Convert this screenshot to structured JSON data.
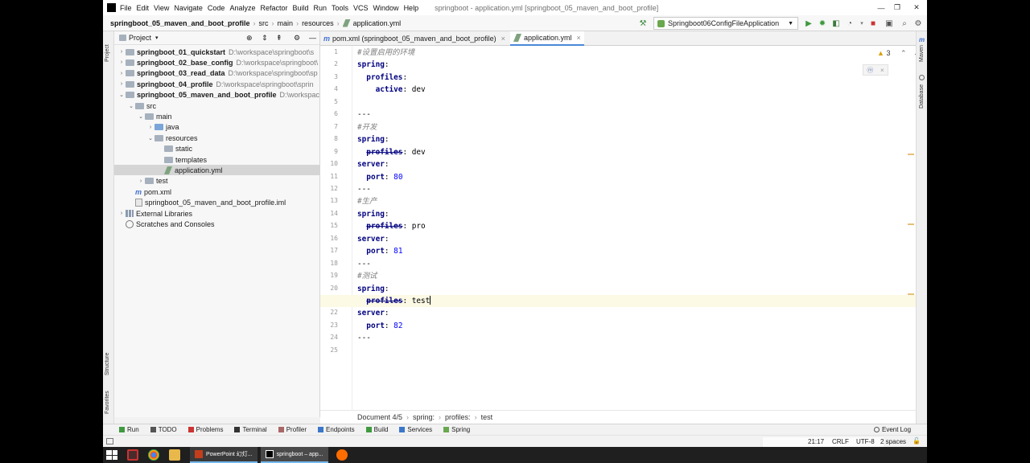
{
  "menu": [
    "File",
    "Edit",
    "View",
    "Navigate",
    "Code",
    "Analyze",
    "Refactor",
    "Build",
    "Run",
    "Tools",
    "VCS",
    "Window",
    "Help"
  ],
  "window_title": "springboot - application.yml [springboot_05_maven_and_boot_profile]",
  "window_controls": {
    "minimize": "—",
    "maximize": "❐",
    "close": "✕"
  },
  "breadcrumbs": [
    "springboot_05_maven_and_boot_profile",
    "src",
    "main",
    "resources",
    "application.yml"
  ],
  "run_config": "Springboot06ConfigFileApplication",
  "project_panel": {
    "title": "Project"
  },
  "tree": [
    {
      "indent": 0,
      "arrow": "›",
      "icon": "folder",
      "label": "springboot_01_quickstart",
      "path": "D:\\workspace\\springboot\\s",
      "bold": true
    },
    {
      "indent": 0,
      "arrow": "›",
      "icon": "folder",
      "label": "springboot_02_base_config",
      "path": "D:\\workspace\\springboot\\",
      "bold": true
    },
    {
      "indent": 0,
      "arrow": "›",
      "icon": "folder",
      "label": "springboot_03_read_data",
      "path": "D:\\workspace\\springboot\\sp",
      "bold": true
    },
    {
      "indent": 0,
      "arrow": "›",
      "icon": "folder",
      "label": "springboot_04_profile",
      "path": "D:\\workspace\\springboot\\sprin",
      "bold": true
    },
    {
      "indent": 0,
      "arrow": "⌄",
      "icon": "folder",
      "label": "springboot_05_maven_and_boot_profile",
      "path": "D:\\workspac",
      "bold": true
    },
    {
      "indent": 1,
      "arrow": "⌄",
      "icon": "folder",
      "label": "src",
      "path": "",
      "bold": false
    },
    {
      "indent": 2,
      "arrow": "⌄",
      "icon": "folder",
      "label": "main",
      "path": "",
      "bold": false
    },
    {
      "indent": 3,
      "arrow": "›",
      "icon": "folder-blue",
      "label": "java",
      "path": "",
      "bold": false
    },
    {
      "indent": 3,
      "arrow": "⌄",
      "icon": "folder",
      "label": "resources",
      "path": "",
      "bold": false
    },
    {
      "indent": 4,
      "arrow": "",
      "icon": "folder",
      "label": "static",
      "path": "",
      "bold": false
    },
    {
      "indent": 4,
      "arrow": "",
      "icon": "folder",
      "label": "templates",
      "path": "",
      "bold": false
    },
    {
      "indent": 4,
      "arrow": "",
      "icon": "yml",
      "label": "application.yml",
      "path": "",
      "bold": false,
      "selected": true
    },
    {
      "indent": 2,
      "arrow": "›",
      "icon": "folder",
      "label": "test",
      "path": "",
      "bold": false
    },
    {
      "indent": 1,
      "arrow": "",
      "icon": "maven",
      "label": "pom.xml",
      "path": "",
      "bold": false
    },
    {
      "indent": 1,
      "arrow": "",
      "icon": "file",
      "label": "springboot_05_maven_and_boot_profile.iml",
      "path": "",
      "bold": false
    },
    {
      "indent": 0,
      "arrow": "›",
      "icon": "lib",
      "label": "External Libraries",
      "path": "",
      "bold": false
    },
    {
      "indent": 0,
      "arrow": "",
      "icon": "scratch",
      "label": "Scratches and Consoles",
      "path": "",
      "bold": false
    }
  ],
  "tabs": [
    {
      "label": "pom.xml (springboot_05_maven_and_boot_profile)",
      "icon": "m",
      "active": false
    },
    {
      "label": "application.yml",
      "icon": "yml",
      "active": true
    }
  ],
  "warnings": "3",
  "code_lines": [
    [
      {
        "t": "c",
        "s": "#设置启用的环境"
      }
    ],
    [
      {
        "t": "k",
        "s": "spring"
      },
      {
        "t": "p",
        "s": ":"
      }
    ],
    [
      {
        "t": "v",
        "s": "  "
      },
      {
        "t": "k",
        "s": "profiles"
      },
      {
        "t": "p",
        "s": ":"
      }
    ],
    [
      {
        "t": "v",
        "s": "    "
      },
      {
        "t": "k",
        "s": "active"
      },
      {
        "t": "p",
        "s": ": "
      },
      {
        "t": "v",
        "s": "dev"
      }
    ],
    [],
    [
      {
        "t": "p",
        "s": "---"
      }
    ],
    [
      {
        "t": "c",
        "s": "#开发"
      }
    ],
    [
      {
        "t": "k",
        "s": "spring"
      },
      {
        "t": "p",
        "s": ":"
      }
    ],
    [
      {
        "t": "v",
        "s": "  "
      },
      {
        "t": "ks",
        "s": "profiles"
      },
      {
        "t": "p",
        "s": ": "
      },
      {
        "t": "v",
        "s": "dev"
      }
    ],
    [
      {
        "t": "k",
        "s": "server"
      },
      {
        "t": "p",
        "s": ":"
      }
    ],
    [
      {
        "t": "v",
        "s": "  "
      },
      {
        "t": "k",
        "s": "port"
      },
      {
        "t": "p",
        "s": ": "
      },
      {
        "t": "n",
        "s": "80"
      }
    ],
    [
      {
        "t": "p",
        "s": "---"
      }
    ],
    [
      {
        "t": "c",
        "s": "#生产"
      }
    ],
    [
      {
        "t": "k",
        "s": "spring"
      },
      {
        "t": "p",
        "s": ":"
      }
    ],
    [
      {
        "t": "v",
        "s": "  "
      },
      {
        "t": "ks",
        "s": "profiles"
      },
      {
        "t": "p",
        "s": ": "
      },
      {
        "t": "v",
        "s": "pro"
      }
    ],
    [
      {
        "t": "k",
        "s": "server"
      },
      {
        "t": "p",
        "s": ":"
      }
    ],
    [
      {
        "t": "v",
        "s": "  "
      },
      {
        "t": "k",
        "s": "port"
      },
      {
        "t": "p",
        "s": ": "
      },
      {
        "t": "n",
        "s": "81"
      }
    ],
    [
      {
        "t": "p",
        "s": "---"
      }
    ],
    [
      {
        "t": "c",
        "s": "#测试"
      }
    ],
    [
      {
        "t": "k",
        "s": "spring"
      },
      {
        "t": "p",
        "s": ":"
      }
    ],
    [
      {
        "t": "v",
        "s": "  "
      },
      {
        "t": "ks",
        "s": "profiles"
      },
      {
        "t": "p",
        "s": ": "
      },
      {
        "t": "v",
        "s": "test"
      }
    ],
    [
      {
        "t": "k",
        "s": "server"
      },
      {
        "t": "p",
        "s": ":"
      }
    ],
    [
      {
        "t": "v",
        "s": "  "
      },
      {
        "t": "k",
        "s": "port"
      },
      {
        "t": "p",
        "s": ": "
      },
      {
        "t": "n",
        "s": "82"
      }
    ],
    [
      {
        "t": "p",
        "s": "---"
      }
    ],
    []
  ],
  "current_line": 21,
  "editor_breadcrumb": [
    "Document 4/5",
    "spring:",
    "profiles:",
    "test"
  ],
  "side_labels": {
    "project": "Project",
    "structure": "Structure",
    "favorites": "Favorites",
    "maven": "Maven",
    "database": "Database"
  },
  "tool_windows": [
    "Run",
    "TODO",
    "Problems",
    "Terminal",
    "Profiler",
    "Endpoints",
    "Build",
    "Services",
    "Spring"
  ],
  "event_log": "Event Log",
  "status": {
    "position": "21:17",
    "line_sep": "CRLF",
    "encoding": "UTF-8",
    "indent": "2 spaces"
  },
  "taskbar": {
    "tasks": [
      "PowerPoint 幻灯...",
      "springboot – app..."
    ]
  }
}
